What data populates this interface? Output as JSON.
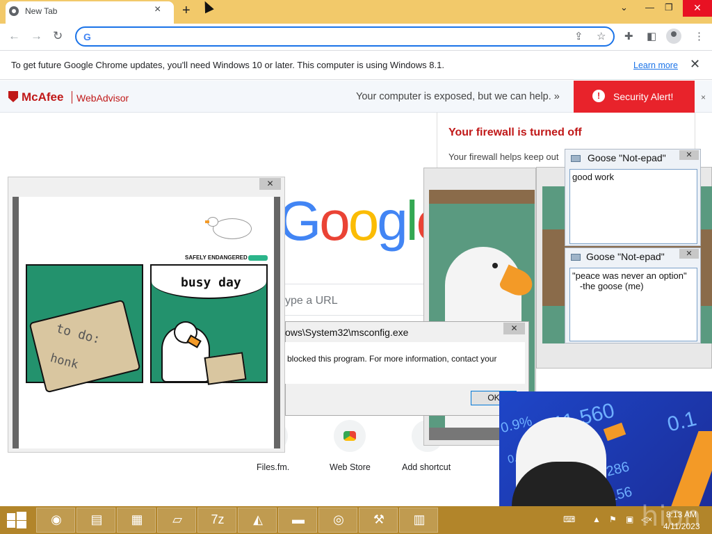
{
  "browser": {
    "tab_title": "New Tab",
    "tab_close": "×",
    "new_tab": "+",
    "win_min": "—",
    "win_max": "❐",
    "win_close": "✕",
    "win_dropdown": "⌄",
    "omnibox_value": "",
    "omnibox_icon": "G"
  },
  "infobar": {
    "text": "To get future Google Chrome updates, you'll need Windows 10 or later. This computer is using Windows 8.1.",
    "link": "Learn more",
    "close": "✕"
  },
  "mcafee": {
    "brand": "McAfee",
    "product": "WebAdvisor",
    "message": "Your computer is exposed, but we can help. »",
    "alert_icon": "!",
    "alert": "Security Alert!",
    "close": "×",
    "popup_title": "Your firewall is turned off",
    "popup_text": "Your firewall helps keep out"
  },
  "newtab_page": {
    "logo": [
      {
        "ch": "G",
        "color": "#4285f4"
      },
      {
        "ch": "o",
        "color": "#ea4335"
      },
      {
        "ch": "o",
        "color": "#fbbc05"
      },
      {
        "ch": "g",
        "color": "#4285f4"
      },
      {
        "ch": "l",
        "color": "#34a853"
      },
      {
        "ch": "e",
        "color": "#ea4335"
      }
    ],
    "search_hint": "ype a URL",
    "shortcuts": [
      "Files.fm.",
      "Web Store",
      "Add shortcut"
    ]
  },
  "comic_window": {
    "close": "✕",
    "panel1_text1": "to do:",
    "panel1_text2": "honk",
    "panel2_text": "busy day",
    "badge": "SAFELY ENDANGERED"
  },
  "msconfig_dialog": {
    "title": "ows\\System32\\msconfig.exe",
    "message": "blocked this program. For more information, contact your",
    "ok": "OK",
    "close": "✕"
  },
  "notepads": [
    {
      "title": "Goose \"Not-epad\"",
      "content": "good work",
      "close": "✕"
    },
    {
      "title": "Goose \"Not-epad\"",
      "content": "\"peace was never an option\"\n   -the goose (me)",
      "close": "✕"
    }
  ],
  "stock_image": {
    "numbers": [
      "11.560",
      "0.1",
      "0.9%",
      "286",
      "156",
      "0.12%"
    ]
  },
  "taskbar": {
    "apps": [
      "chrome",
      "file-explorer",
      "store",
      "notepad",
      "7zip",
      "app",
      "cmd",
      "disc",
      "tool",
      "monitor"
    ],
    "time": "8:13 AM",
    "date": "4/11/2023",
    "watermark": "hion"
  }
}
